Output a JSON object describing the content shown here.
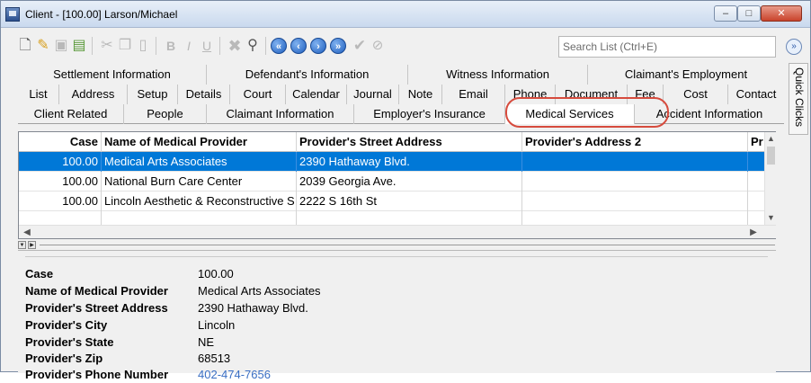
{
  "window": {
    "title": "Client - [100.00] Larson/Michael",
    "minimize": "–",
    "maximize": "□",
    "close": "✕"
  },
  "toolbar": {
    "search_placeholder": "Search List (Ctrl+E)",
    "collapse_glyph": "»",
    "icons": [
      "new-document-icon",
      "open-folder-icon",
      "save-icon",
      "save-close-icon",
      "cut-icon",
      "copy-icon",
      "paste-icon",
      "bold-icon",
      "italic-icon",
      "underline-icon",
      "delete-icon",
      "find-icon",
      "first-record-icon",
      "previous-record-icon",
      "next-record-icon",
      "last-record-icon",
      "check-icon",
      "cancel-icon"
    ]
  },
  "quick_clicks": {
    "label": "Quick Clicks"
  },
  "tabs": {
    "row1": [
      "Settlement Information",
      "Defendant's Information",
      "Witness Information",
      "Claimant's Employment"
    ],
    "row2": [
      "List",
      "Address",
      "Setup",
      "Details",
      "Court",
      "Calendar",
      "Journal",
      "Note",
      "Email",
      "Phone",
      "Document",
      "Fee",
      "Cost",
      "Contact"
    ],
    "row3": [
      "Client Related",
      "People",
      "Claimant Information",
      "Employer's Insurance",
      "Medical Services",
      "Accident Information"
    ],
    "active": "Medical Services"
  },
  "grid": {
    "columns": [
      "Case",
      "Name of Medical Provider",
      "Provider's Street Address",
      "Provider's Address 2",
      "Pr"
    ],
    "rows": [
      {
        "case": "100.00",
        "name": "Medical Arts Associates",
        "street": "2390 Hathaway Blvd.",
        "address2": ""
      },
      {
        "case": "100.00",
        "name": "National Burn Care Center",
        "street": "2039 Georgia Ave.",
        "address2": ""
      },
      {
        "case": "100.00",
        "name": "Lincoln Aesthetic & Reconstructive S",
        "street": "2222 S 16th St",
        "address2": ""
      }
    ],
    "selected_row": 0
  },
  "detail": {
    "fields": [
      {
        "label": "Case",
        "value": "100.00"
      },
      {
        "label": "Name of Medical Provider",
        "value": "Medical Arts Associates"
      },
      {
        "label": "Provider's Street Address",
        "value": "2390 Hathaway Blvd."
      },
      {
        "label": "Provider's City",
        "value": "Lincoln"
      },
      {
        "label": "Provider's State",
        "value": "NE"
      },
      {
        "label": "Provider's Zip",
        "value": "68513"
      },
      {
        "label": "Provider's Phone Number",
        "value": "402-474-7656"
      }
    ]
  },
  "colors": {
    "selection": "#0078d7",
    "highlight_ring": "#d64b3d",
    "link": "#3a6fc4"
  }
}
